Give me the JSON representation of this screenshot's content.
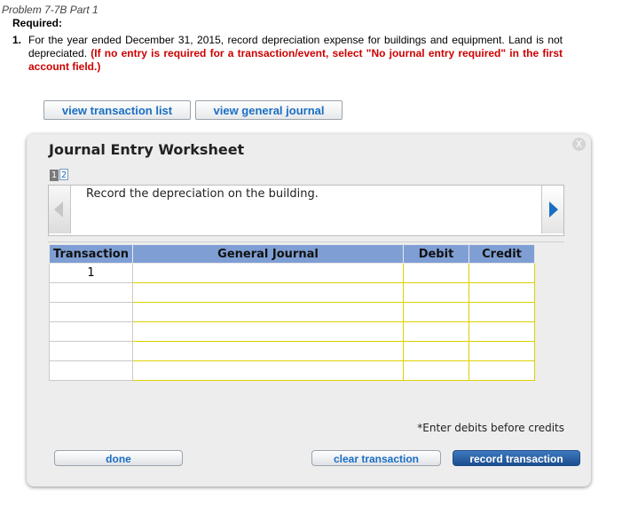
{
  "problem": {
    "title": "Problem 7-7B Part 1",
    "required_label": "Required:",
    "item_number": "1.",
    "instruction": "For the year ended December 31, 2015, record depreciation expense for buildings and equipment. Land is not depreciated.",
    "instruction_red": "(If no entry is required for a transaction/event, select \"No journal entry required\" in the first account field.)"
  },
  "top_buttons": {
    "view_transaction_list": "view transaction list",
    "view_general_journal": "view general journal"
  },
  "worksheet": {
    "title": "Journal Entry Worksheet",
    "close_label": "X",
    "pages": [
      "1",
      "2"
    ],
    "description": "Record the depreciation on the building.",
    "columns": [
      "Transaction",
      "General Journal",
      "Debit",
      "Credit"
    ],
    "rows": [
      {
        "transaction": "1",
        "account": "",
        "debit": "",
        "credit": ""
      },
      {
        "transaction": "",
        "account": "",
        "debit": "",
        "credit": ""
      },
      {
        "transaction": "",
        "account": "",
        "debit": "",
        "credit": ""
      },
      {
        "transaction": "",
        "account": "",
        "debit": "",
        "credit": ""
      },
      {
        "transaction": "",
        "account": "",
        "debit": "",
        "credit": ""
      },
      {
        "transaction": "",
        "account": "",
        "debit": "",
        "credit": ""
      }
    ],
    "note": "*Enter debits before credits",
    "buttons": {
      "done": "done",
      "clear": "clear transaction",
      "record": "record transaction"
    }
  }
}
